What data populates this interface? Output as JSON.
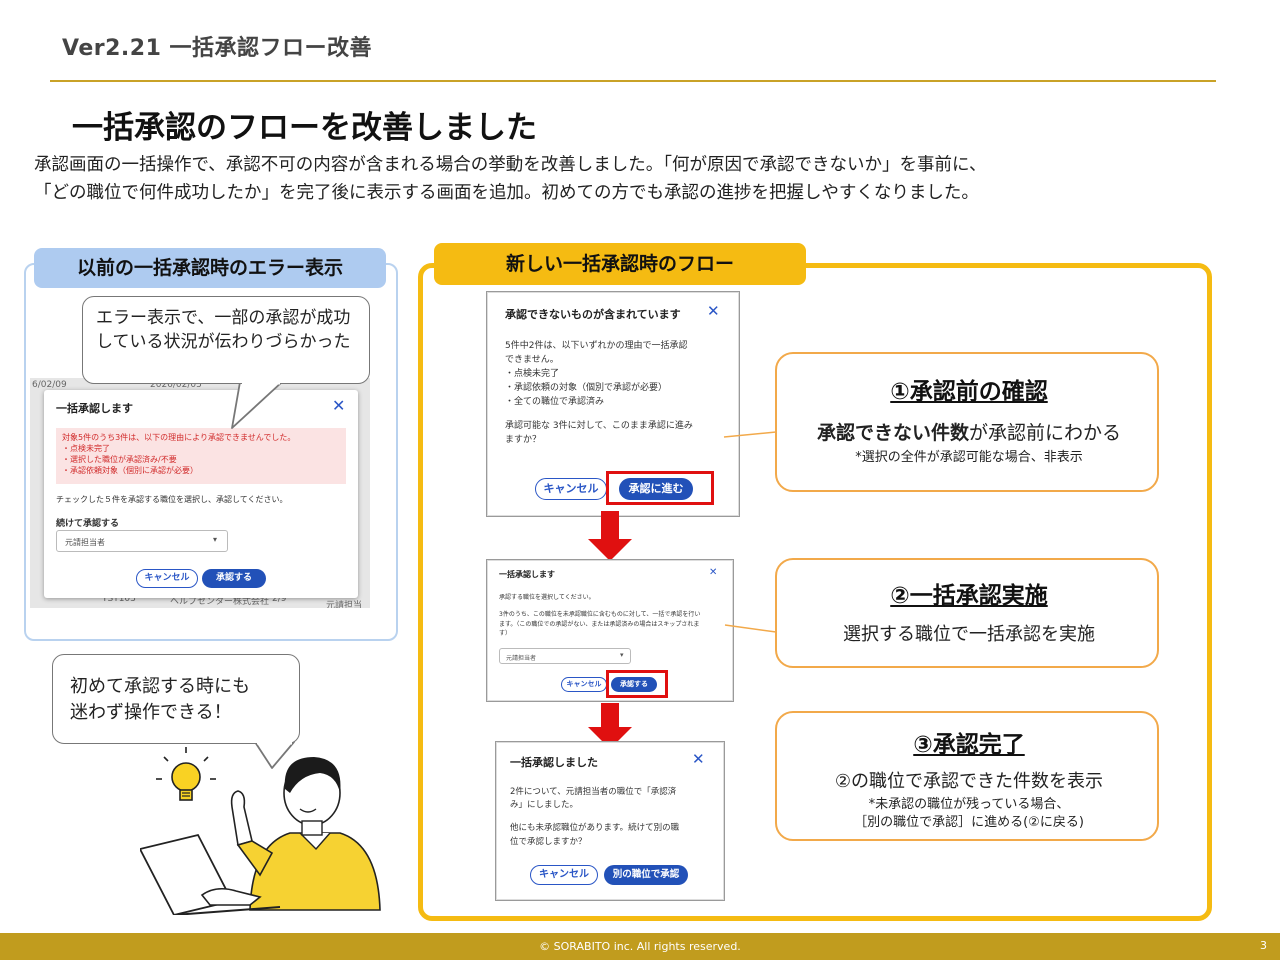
{
  "header": {
    "version_title": "Ver2.21  一括承認フロー改善",
    "main_title": "一括承認のフローを改善しました",
    "description_line1": "承認画面の一括操作で、承認不可の内容が含まれる場合の挙動を改善しました。「何が原因で承認できないか」を事前に、",
    "description_line2": "「どの職位で何件成功したか」を完了後に表示する画面を追加。初めての方でも承認の進捗を把握しやすくなりました。"
  },
  "left": {
    "label": "以前の一括承認時のエラー表示",
    "bubble_text": "エラー表示で、一部の承認が成功している状況が伝わりづらかった",
    "bg_texts": [
      "6/02/09",
      "2026/02/05",
      "TST103",
      "ヘルプセンター株式会社",
      "2/9",
      "元請担当者"
    ],
    "dialog": {
      "title": "一括承認します",
      "error_lines": [
        "対象5件のうち3件は、以下の理由により承認できませんでした。",
        "・点検未完了",
        "・選択した職位が承認済み/不要",
        "・承認依頼対象（個別に承認が必要）"
      ],
      "instruction": "チェックした５件を承認する職位を選択し、承認してください。",
      "continue_label": "続けて承認する",
      "select_value": "元請担当者",
      "cancel_label": "キャンセル",
      "approve_label": "承認する"
    },
    "bubble2_text_line1": "初めて承認する時にも",
    "bubble2_text_line2": "迷わず操作できる！"
  },
  "right": {
    "label": "新しい一括承認時のフロー",
    "dialog1": {
      "title": "承認できないものが含まれています",
      "lines": [
        "5件中2件は、以下いずれかの理由で一括承認",
        "できません。",
        "・点検未完了",
        "・承認依頼の対象（個別で承認が必要）",
        "・全ての職位で承認済み"
      ],
      "question_line1": "承認可能な 3件に対して、このまま承認に進み",
      "question_line2": "ますか？",
      "cancel_label": "キャンセル",
      "proceed_label": "承認に進む"
    },
    "dialog2": {
      "title": "一括承認します",
      "line1": "承認する職位を選択してください。",
      "line2": "3件のうち、この職位を未承認職位に含むものに対して、一括で承認を行い",
      "line3": "ます。（この職位での承認がない、または承認済みの場合はスキップされま",
      "line4": "す）",
      "select_value": "元請担当者",
      "cancel_label": "キャンセル",
      "approve_label": "承認する"
    },
    "dialog3": {
      "title": "一括承認しました",
      "line1": "2件について、元請担当者の職位で「承認済",
      "line2": "み」にしました。",
      "line3": "他にも未承認職位があります。続けて別の職",
      "line4": "位で承認しますか？",
      "cancel_label": "キャンセル",
      "other_label": "別の職位で承認"
    },
    "step1": {
      "title": "①承認前の確認",
      "main_bold": "承認できない件数",
      "main_rest": "が承認前にわかる",
      "note": "*選択の全件が承認可能な場合、非表示"
    },
    "step2": {
      "title": "②一括承認実施",
      "main": "選択する職位で一括承認を実施"
    },
    "step3": {
      "title": "③承認完了",
      "main": "②の職位で承認できた件数を表示",
      "note1": "*未承認の職位が残っている場合、",
      "note2": "［別の職位で承認］に進める(②に戻る)"
    }
  },
  "footer": {
    "copyright": "© SORABITO inc. All rights reserved.",
    "page_number": "3"
  },
  "colors": {
    "gold": "#c19c1e",
    "yellow": "#f5bb12",
    "blue_label": "#aecbf0",
    "button_blue": "#2251b8",
    "red": "#e01010",
    "orange_border": "#f2a94a"
  }
}
